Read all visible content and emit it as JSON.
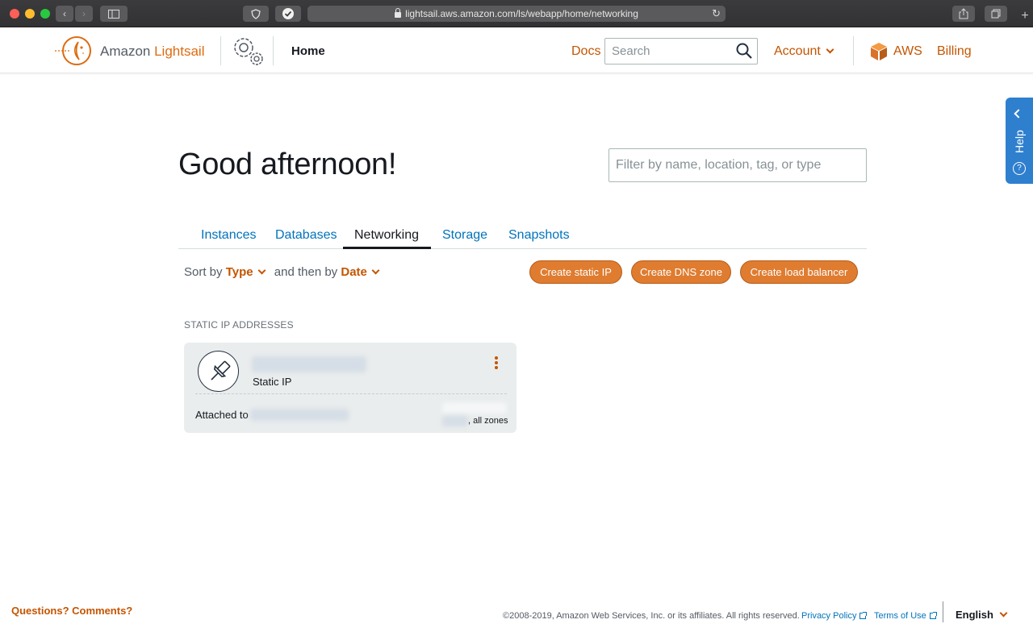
{
  "browser": {
    "url": "lightsail.aws.amazon.com/ls/webapp/home/networking"
  },
  "header": {
    "brand_prefix": "Amazon ",
    "brand_accent": "Lightsail",
    "home": "Home",
    "docs": "Docs",
    "search_placeholder": "Search",
    "account": "Account",
    "aws": "AWS",
    "billing": "Billing"
  },
  "help": {
    "label": "Help"
  },
  "main": {
    "greeting": "Good afternoon!",
    "filter_placeholder": "Filter by name, location, tag, or type",
    "tabs": [
      {
        "label": "Instances"
      },
      {
        "label": "Databases"
      },
      {
        "label": "Networking",
        "active": true
      },
      {
        "label": "Storage"
      },
      {
        "label": "Snapshots"
      }
    ],
    "sort": {
      "sort_by": "Sort by",
      "sort_value": "Type",
      "then_by": "and then by",
      "then_value": "Date"
    },
    "buttons": {
      "create_static_ip": "Create static IP",
      "create_dns_zone": "Create DNS zone",
      "create_load_balancer": "Create load balancer"
    },
    "section_title": "STATIC IP ADDRESSES",
    "card": {
      "type": "Static IP",
      "attached_label": "Attached to",
      "zones": ", all zones"
    }
  },
  "footer": {
    "questions": "Questions? Comments?",
    "copyright": "©2008-2019, Amazon Web Services, Inc. or its affiliates. All rights reserved.",
    "privacy": "Privacy Policy",
    "terms": "Terms of Use",
    "language": "English"
  },
  "colors": {
    "accent_orange": "#c45500",
    "button_orange": "#df7c30",
    "link_blue": "#0073bb",
    "help_blue": "#2f7fcf"
  }
}
